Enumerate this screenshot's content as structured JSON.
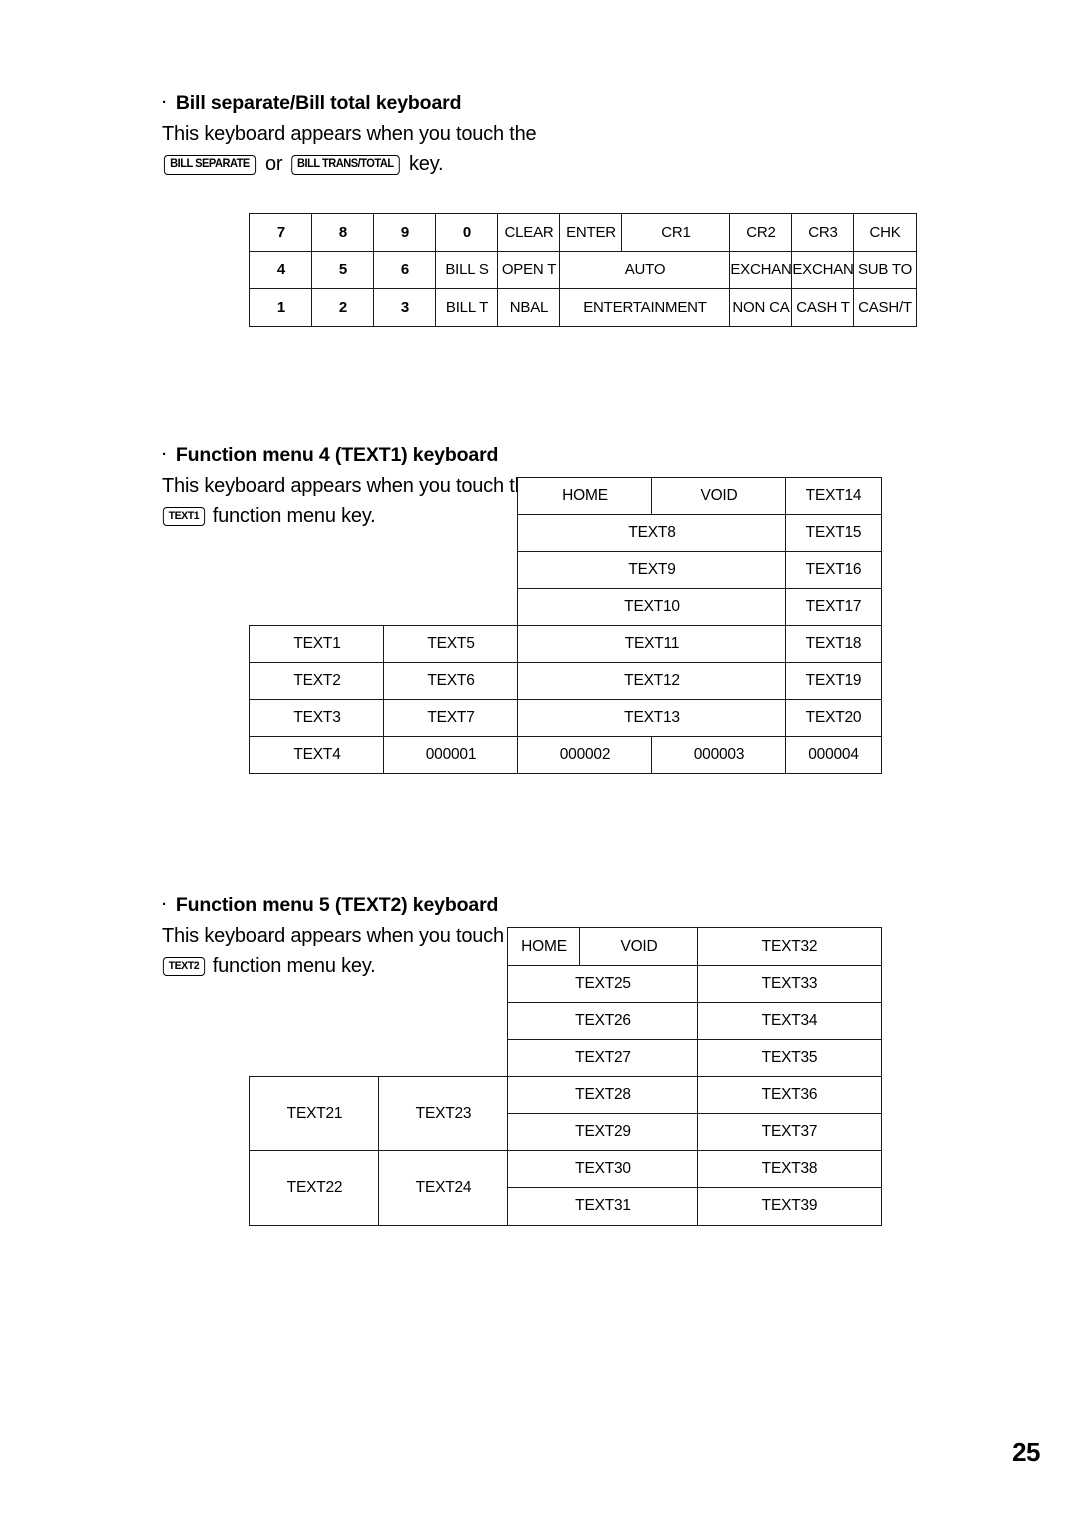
{
  "page": {
    "number": "25"
  },
  "sections": [
    {
      "bullet": "·",
      "heading": "Bill separate/Bill total keyboard",
      "line1": "This keyboard appears when you touch the",
      "key1": "BILL SEPARATE",
      "conjunction": "or",
      "key2": "BILL TRANS/TOTAL",
      "line2_tail": "key."
    },
    {
      "bullet": "·",
      "heading": "Function menu 4 (TEXT1) keyboard",
      "line1": "This keyboard appears when you touch the",
      "key1": "TEXT1",
      "line2_tail": "function menu key."
    },
    {
      "bullet": "·",
      "heading": "Function menu 5 (TEXT2) keyboard",
      "line1": "This keyboard appears when you touch the",
      "key1": "TEXT2",
      "line2_tail": "function menu key."
    }
  ],
  "keyboards": {
    "bill": {
      "name": "Bill separate/Bill total keyboard",
      "cells": [
        {
          "label": "7",
          "bold": true,
          "col": 1,
          "colspan": 1,
          "row": 1
        },
        {
          "label": "8",
          "bold": true,
          "col": 2,
          "colspan": 1,
          "row": 1
        },
        {
          "label": "9",
          "bold": true,
          "col": 3,
          "colspan": 1,
          "row": 1
        },
        {
          "label": "0",
          "bold": true,
          "col": 4,
          "colspan": 1,
          "row": 1
        },
        {
          "label": "CLEAR",
          "bold": false,
          "col": 5,
          "colspan": 1,
          "row": 1
        },
        {
          "label": "ENTER",
          "bold": false,
          "col": 6,
          "colspan": 1,
          "row": 1
        },
        {
          "label": "CR1",
          "bold": false,
          "col": 7,
          "colspan": 1,
          "row": 1
        },
        {
          "label": "CR2",
          "bold": false,
          "col": 8,
          "colspan": 1,
          "row": 1
        },
        {
          "label": "CR3",
          "bold": false,
          "col": 9,
          "colspan": 1,
          "row": 1
        },
        {
          "label": "CHK",
          "bold": false,
          "col": 10,
          "colspan": 1,
          "row": 1
        },
        {
          "label": "4",
          "bold": true,
          "col": 1,
          "colspan": 1,
          "row": 2
        },
        {
          "label": "5",
          "bold": true,
          "col": 2,
          "colspan": 1,
          "row": 2
        },
        {
          "label": "6",
          "bold": true,
          "col": 3,
          "colspan": 1,
          "row": 2
        },
        {
          "label": "BILL S",
          "bold": false,
          "col": 4,
          "colspan": 1,
          "row": 2
        },
        {
          "label": "OPEN T",
          "bold": false,
          "col": 5,
          "colspan": 1,
          "row": 2
        },
        {
          "label": "AUTO",
          "bold": false,
          "col": 6,
          "colspan": 2,
          "row": 2
        },
        {
          "label": "EXCHAN",
          "bold": false,
          "col": 8,
          "colspan": 1,
          "row": 2
        },
        {
          "label": "EXCHAN",
          "bold": false,
          "col": 9,
          "colspan": 1,
          "row": 2
        },
        {
          "label": "SUB TO",
          "bold": false,
          "col": 10,
          "colspan": 1,
          "row": 2
        },
        {
          "label": "1",
          "bold": true,
          "col": 1,
          "colspan": 1,
          "row": 3
        },
        {
          "label": "2",
          "bold": true,
          "col": 2,
          "colspan": 1,
          "row": 3
        },
        {
          "label": "3",
          "bold": true,
          "col": 3,
          "colspan": 1,
          "row": 3
        },
        {
          "label": "BILL T",
          "bold": false,
          "col": 4,
          "colspan": 1,
          "row": 3
        },
        {
          "label": "NBAL",
          "bold": false,
          "col": 5,
          "colspan": 1,
          "row": 3
        },
        {
          "label": "ENTERTAINMENT",
          "bold": false,
          "col": 6,
          "colspan": 2,
          "row": 3
        },
        {
          "label": "NON CA",
          "bold": false,
          "col": 8,
          "colspan": 1,
          "row": 3
        },
        {
          "label": "CASH T",
          "bold": false,
          "col": 9,
          "colspan": 1,
          "row": 3
        },
        {
          "label": "CASH/T",
          "bold": false,
          "col": 10,
          "colspan": 1,
          "row": 3
        }
      ]
    },
    "text1": {
      "name": "Function menu 4 (TEXT1) keyboard",
      "cells": [
        {
          "label": "",
          "blank": true,
          "col": 1,
          "colspan": 2,
          "row": 1,
          "rowspan": 4
        },
        {
          "label": "HOME",
          "col": 3,
          "colspan": 1,
          "row": 1,
          "rowspan": 1
        },
        {
          "label": "VOID",
          "col": 4,
          "colspan": 1,
          "row": 1,
          "rowspan": 1
        },
        {
          "label": "TEXT14",
          "col": 5,
          "colspan": 1,
          "row": 1,
          "rowspan": 1
        },
        {
          "label": "TEXT8",
          "col": 3,
          "colspan": 2,
          "row": 2,
          "rowspan": 1
        },
        {
          "label": "TEXT15",
          "col": 5,
          "colspan": 1,
          "row": 2,
          "rowspan": 1
        },
        {
          "label": "TEXT9",
          "col": 3,
          "colspan": 2,
          "row": 3,
          "rowspan": 1
        },
        {
          "label": "TEXT16",
          "col": 5,
          "colspan": 1,
          "row": 3,
          "rowspan": 1
        },
        {
          "label": "TEXT10",
          "col": 3,
          "colspan": 2,
          "row": 4,
          "rowspan": 1
        },
        {
          "label": "TEXT17",
          "col": 5,
          "colspan": 1,
          "row": 4,
          "rowspan": 1
        },
        {
          "label": "TEXT1",
          "col": 1,
          "colspan": 1,
          "row": 5,
          "rowspan": 1
        },
        {
          "label": "TEXT5",
          "col": 2,
          "colspan": 1,
          "row": 5,
          "rowspan": 1
        },
        {
          "label": "TEXT11",
          "col": 3,
          "colspan": 2,
          "row": 5,
          "rowspan": 1
        },
        {
          "label": "TEXT18",
          "col": 5,
          "colspan": 1,
          "row": 5,
          "rowspan": 1
        },
        {
          "label": "TEXT2",
          "col": 1,
          "colspan": 1,
          "row": 6,
          "rowspan": 1
        },
        {
          "label": "TEXT6",
          "col": 2,
          "colspan": 1,
          "row": 6,
          "rowspan": 1
        },
        {
          "label": "TEXT12",
          "col": 3,
          "colspan": 2,
          "row": 6,
          "rowspan": 1
        },
        {
          "label": "TEXT19",
          "col": 5,
          "colspan": 1,
          "row": 6,
          "rowspan": 1
        },
        {
          "label": "TEXT3",
          "col": 1,
          "colspan": 1,
          "row": 7,
          "rowspan": 1
        },
        {
          "label": "TEXT7",
          "col": 2,
          "colspan": 1,
          "row": 7,
          "rowspan": 1
        },
        {
          "label": "TEXT13",
          "col": 3,
          "colspan": 2,
          "row": 7,
          "rowspan": 1
        },
        {
          "label": "TEXT20",
          "col": 5,
          "colspan": 1,
          "row": 7,
          "rowspan": 1
        },
        {
          "label": "TEXT4",
          "col": 1,
          "colspan": 1,
          "row": 8,
          "rowspan": 1
        },
        {
          "label": "000001",
          "col": 2,
          "colspan": 1,
          "row": 8,
          "rowspan": 1
        },
        {
          "label": "000002",
          "col": 3,
          "colspan": 1,
          "row": 8,
          "rowspan": 1
        },
        {
          "label": "000003",
          "col": 4,
          "colspan": 1,
          "row": 8,
          "rowspan": 1
        },
        {
          "label": "000004",
          "col": 5,
          "colspan": 1,
          "row": 8,
          "rowspan": 1
        }
      ]
    },
    "text2": {
      "name": "Function menu 5 (TEXT2) keyboard",
      "cells": [
        {
          "label": "",
          "blank": true,
          "col": 1,
          "colspan": 2,
          "row": 1,
          "rowspan": 4
        },
        {
          "label": "HOME",
          "col": 3,
          "colspan": 1,
          "row": 1,
          "rowspan": 1
        },
        {
          "label": "VOID",
          "col": 4,
          "colspan": 1,
          "row": 1,
          "rowspan": 1
        },
        {
          "label": "TEXT32",
          "col": 5,
          "colspan": 1,
          "row": 1,
          "rowspan": 1
        },
        {
          "label": "TEXT25",
          "col": 3,
          "colspan": 2,
          "row": 2,
          "rowspan": 1
        },
        {
          "label": "TEXT33",
          "col": 5,
          "colspan": 1,
          "row": 2,
          "rowspan": 1
        },
        {
          "label": "TEXT26",
          "col": 3,
          "colspan": 2,
          "row": 3,
          "rowspan": 1
        },
        {
          "label": "TEXT34",
          "col": 5,
          "colspan": 1,
          "row": 3,
          "rowspan": 1
        },
        {
          "label": "TEXT27",
          "col": 3,
          "colspan": 2,
          "row": 4,
          "rowspan": 1
        },
        {
          "label": "TEXT35",
          "col": 5,
          "colspan": 1,
          "row": 4,
          "rowspan": 1
        },
        {
          "label": "TEXT21",
          "col": 1,
          "colspan": 1,
          "row": 5,
          "rowspan": 2
        },
        {
          "label": "TEXT23",
          "col": 2,
          "colspan": 1,
          "row": 5,
          "rowspan": 2
        },
        {
          "label": "TEXT28",
          "col": 3,
          "colspan": 2,
          "row": 5,
          "rowspan": 1
        },
        {
          "label": "TEXT36",
          "col": 5,
          "colspan": 1,
          "row": 5,
          "rowspan": 1
        },
        {
          "label": "TEXT29",
          "col": 3,
          "colspan": 2,
          "row": 6,
          "rowspan": 1
        },
        {
          "label": "TEXT37",
          "col": 5,
          "colspan": 1,
          "row": 6,
          "rowspan": 1
        },
        {
          "label": "TEXT22",
          "col": 1,
          "colspan": 1,
          "row": 7,
          "rowspan": 2
        },
        {
          "label": "TEXT24",
          "col": 2,
          "colspan": 1,
          "row": 7,
          "rowspan": 2
        },
        {
          "label": "TEXT30",
          "col": 3,
          "colspan": 2,
          "row": 7,
          "rowspan": 1
        },
        {
          "label": "TEXT38",
          "col": 5,
          "colspan": 1,
          "row": 7,
          "rowspan": 1
        },
        {
          "label": "TEXT31",
          "col": 3,
          "colspan": 2,
          "row": 8,
          "rowspan": 1
        },
        {
          "label": "TEXT39",
          "col": 5,
          "colspan": 1,
          "row": 8,
          "rowspan": 1
        }
      ]
    }
  }
}
